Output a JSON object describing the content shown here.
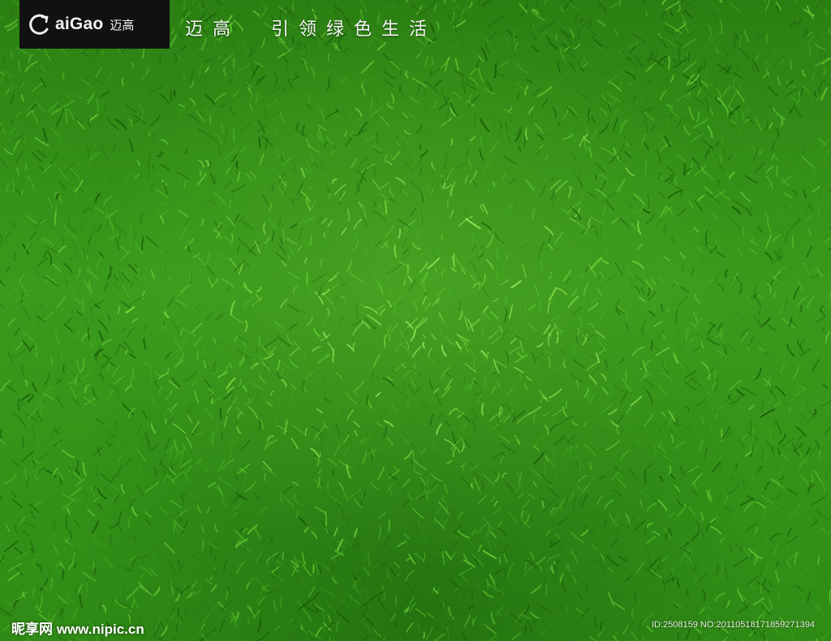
{
  "brand": {
    "logo_text": "aiGao",
    "logo_cn": "迈高",
    "slogan": "迈高  引领绿色生活"
  },
  "watermark": {
    "site": "昵享网 www.nipic.cn",
    "id_text": "ID:2508159 NO:20110518171859271394"
  },
  "colors": {
    "grass_dark": "#1f6a0c",
    "grass_mid": "#3a9a1c",
    "grass_light": "#8ee04a",
    "logo_bg": "#111111"
  }
}
